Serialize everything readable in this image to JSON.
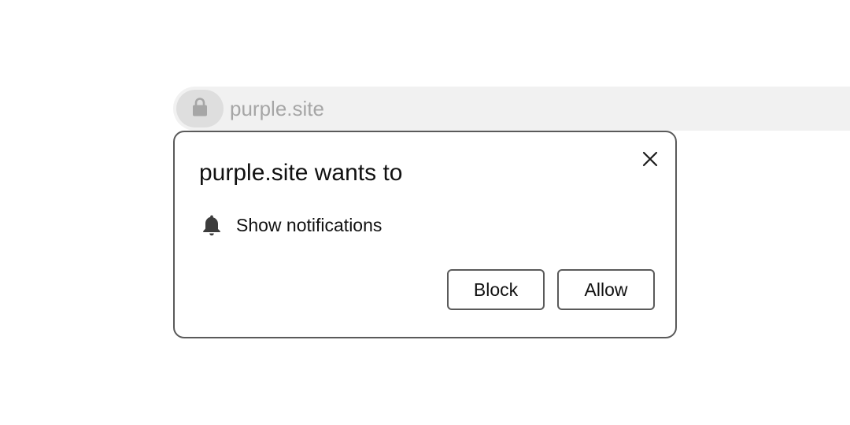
{
  "omnibox": {
    "url": "purple.site",
    "lock_icon": "lock-icon"
  },
  "permission_dialog": {
    "title": "purple.site wants to",
    "close_icon": "close-icon",
    "permission": {
      "icon": "bell-icon",
      "label": "Show notifications"
    },
    "buttons": {
      "block_label": "Block",
      "allow_label": "Allow"
    }
  },
  "colors": {
    "omnibox_background": "#f1f1f1",
    "lock_chip_background": "#dedede",
    "url_text": "#a6a6a6",
    "dialog_border": "#5a5a5a",
    "text": "#111111",
    "icon": "#3c3c3c"
  }
}
